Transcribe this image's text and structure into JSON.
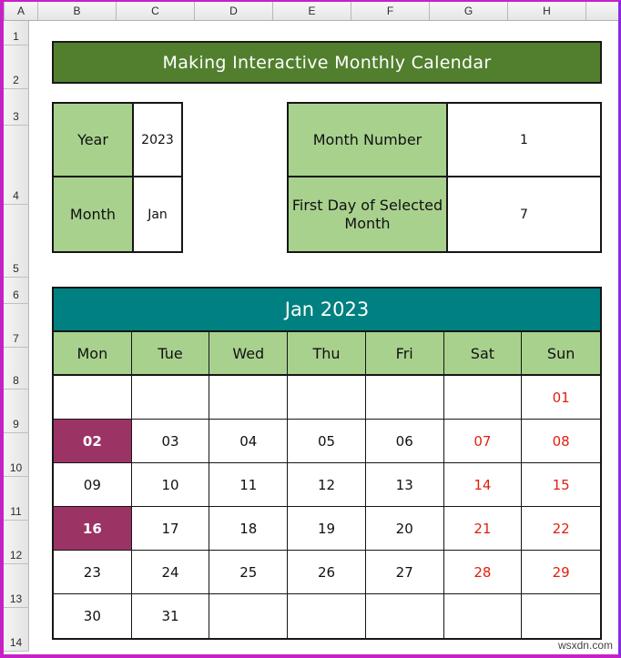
{
  "spreadsheet": {
    "column_headers": [
      "A",
      "B",
      "C",
      "D",
      "E",
      "F",
      "G",
      "H"
    ],
    "row_headers": [
      "1",
      "2",
      "3",
      "4",
      "5",
      "6",
      "7",
      "8",
      "9",
      "10",
      "11",
      "12",
      "13",
      "14"
    ],
    "watermark": "wsxdn.com"
  },
  "title": {
    "text": "Making Interactive Monthly Calendar",
    "background_color": "#517F2E",
    "text_color": "#FFFFFF"
  },
  "info_left": {
    "rows": [
      {
        "label": "Year",
        "value": "2023"
      },
      {
        "label": "Month",
        "value": "Jan"
      }
    ]
  },
  "info_right": {
    "rows": [
      {
        "label": "Month Number",
        "value": "1"
      },
      {
        "label": "First Day of Selected Month",
        "value": "7"
      }
    ]
  },
  "calendar": {
    "header": "Jan 2023",
    "header_color": "#008080",
    "day_names": [
      "Mon",
      "Tue",
      "Wed",
      "Thu",
      "Fri",
      "Sat",
      "Sun"
    ],
    "day_name_background": "#A9D18E",
    "weekend_color": "#E02010",
    "highlight_color": "#9C3365",
    "weeks": [
      [
        {
          "day": "",
          "weekend": false,
          "highlight": false
        },
        {
          "day": "",
          "weekend": false,
          "highlight": false
        },
        {
          "day": "",
          "weekend": false,
          "highlight": false
        },
        {
          "day": "",
          "weekend": false,
          "highlight": false
        },
        {
          "day": "",
          "weekend": false,
          "highlight": false
        },
        {
          "day": "",
          "weekend": false,
          "highlight": false
        },
        {
          "day": "01",
          "weekend": true,
          "highlight": false
        }
      ],
      [
        {
          "day": "02",
          "weekend": false,
          "highlight": true
        },
        {
          "day": "03",
          "weekend": false,
          "highlight": false
        },
        {
          "day": "04",
          "weekend": false,
          "highlight": false
        },
        {
          "day": "05",
          "weekend": false,
          "highlight": false
        },
        {
          "day": "06",
          "weekend": false,
          "highlight": false
        },
        {
          "day": "07",
          "weekend": true,
          "highlight": false
        },
        {
          "day": "08",
          "weekend": true,
          "highlight": false
        }
      ],
      [
        {
          "day": "09",
          "weekend": false,
          "highlight": false
        },
        {
          "day": "10",
          "weekend": false,
          "highlight": false
        },
        {
          "day": "11",
          "weekend": false,
          "highlight": false
        },
        {
          "day": "12",
          "weekend": false,
          "highlight": false
        },
        {
          "day": "13",
          "weekend": false,
          "highlight": false
        },
        {
          "day": "14",
          "weekend": true,
          "highlight": false
        },
        {
          "day": "15",
          "weekend": true,
          "highlight": false
        }
      ],
      [
        {
          "day": "16",
          "weekend": false,
          "highlight": true
        },
        {
          "day": "17",
          "weekend": false,
          "highlight": false
        },
        {
          "day": "18",
          "weekend": false,
          "highlight": false
        },
        {
          "day": "19",
          "weekend": false,
          "highlight": false
        },
        {
          "day": "20",
          "weekend": false,
          "highlight": false
        },
        {
          "day": "21",
          "weekend": true,
          "highlight": false
        },
        {
          "day": "22",
          "weekend": true,
          "highlight": false
        }
      ],
      [
        {
          "day": "23",
          "weekend": false,
          "highlight": false
        },
        {
          "day": "24",
          "weekend": false,
          "highlight": false
        },
        {
          "day": "25",
          "weekend": false,
          "highlight": false
        },
        {
          "day": "26",
          "weekend": false,
          "highlight": false
        },
        {
          "day": "27",
          "weekend": false,
          "highlight": false
        },
        {
          "day": "28",
          "weekend": true,
          "highlight": false
        },
        {
          "day": "29",
          "weekend": true,
          "highlight": false
        }
      ],
      [
        {
          "day": "30",
          "weekend": false,
          "highlight": false
        },
        {
          "day": "31",
          "weekend": false,
          "highlight": false
        },
        {
          "day": "",
          "weekend": false,
          "highlight": false
        },
        {
          "day": "",
          "weekend": false,
          "highlight": false
        },
        {
          "day": "",
          "weekend": false,
          "highlight": false
        },
        {
          "day": "",
          "weekend": false,
          "highlight": false
        },
        {
          "day": "",
          "weekend": false,
          "highlight": false
        }
      ]
    ]
  }
}
